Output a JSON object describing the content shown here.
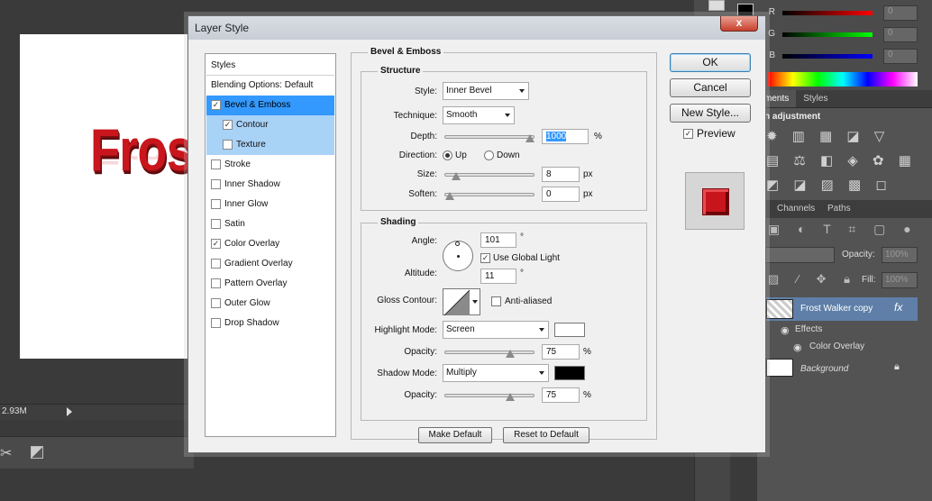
{
  "background": {
    "canvas_text": "Fros",
    "status_size": "2.93M"
  },
  "color_panel": {
    "channels": [
      {
        "label": "R",
        "value": "0",
        "color": "#ff2020"
      },
      {
        "label": "G",
        "value": "0",
        "color": "#20c020"
      },
      {
        "label": "B",
        "value": "0",
        "color": "#2040ff"
      }
    ]
  },
  "adjustments_panel": {
    "tabs": [
      "ments",
      "Styles"
    ],
    "heading": "n adjustment"
  },
  "layers_panel": {
    "tabs": [
      "Channels",
      "Paths"
    ],
    "opacity_label": "Opacity:",
    "opacity_value": "100%",
    "fill_label": "Fill:",
    "fill_value": "100%",
    "layers": [
      {
        "name": "Frost Walker copy",
        "fx": "fx"
      },
      {
        "name": "Effects"
      },
      {
        "name": "Color Overlay"
      },
      {
        "name": "Background"
      }
    ]
  },
  "dialog": {
    "title": "Layer Style",
    "close": "x",
    "styles": [
      {
        "label": "Styles",
        "checkbox": false,
        "checked": false
      },
      {
        "label": "Blending Options: Default",
        "checkbox": false,
        "checked": false
      },
      {
        "label": "Bevel & Emboss",
        "checkbox": true,
        "checked": true
      },
      {
        "label": "Contour",
        "checkbox": true,
        "checked": true
      },
      {
        "label": "Texture",
        "checkbox": true,
        "checked": false
      },
      {
        "label": "Stroke",
        "checkbox": true,
        "checked": false
      },
      {
        "label": "Inner Shadow",
        "checkbox": true,
        "checked": false
      },
      {
        "label": "Inner Glow",
        "checkbox": true,
        "checked": false
      },
      {
        "label": "Satin",
        "checkbox": true,
        "checked": false
      },
      {
        "label": "Color Overlay",
        "checkbox": true,
        "checked": true
      },
      {
        "label": "Gradient Overlay",
        "checkbox": true,
        "checked": false
      },
      {
        "label": "Pattern Overlay",
        "checkbox": true,
        "checked": false
      },
      {
        "label": "Outer Glow",
        "checkbox": true,
        "checked": false
      },
      {
        "label": "Drop Shadow",
        "checkbox": true,
        "checked": false
      }
    ],
    "bevel": {
      "title": "Bevel & Emboss",
      "structure_title": "Structure",
      "style_label": "Style:",
      "style_value": "Inner Bevel",
      "technique_label": "Technique:",
      "technique_value": "Smooth",
      "depth_label": "Depth:",
      "depth_value": "1000",
      "depth_unit": "%",
      "depth_level": 1.0,
      "direction_label": "Direction:",
      "dir_up": "Up",
      "dir_down": "Down",
      "size_label": "Size:",
      "size_value": "8",
      "size_unit": "px",
      "size_level": 0.08,
      "soften_label": "Soften:",
      "soften_value": "0",
      "soften_unit": "px",
      "soften_level": 0.0
    },
    "shading": {
      "title": "Shading",
      "angle_label": "Angle:",
      "angle_value": "101",
      "deg": "°",
      "global_light": "Use Global Light",
      "altitude_label": "Altitude:",
      "altitude_value": "11",
      "gloss_label": "Gloss Contour:",
      "anti_aliased": "Anti-aliased",
      "highlight_label": "Highlight Mode:",
      "highlight_value": "Screen",
      "highlight_color": "#ffffff",
      "opacity_label": "Opacity:",
      "highlight_opacity": "75",
      "shadow_label": "Shadow Mode:",
      "shadow_value": "Multiply",
      "shadow_color": "#000000",
      "shadow_opacity": "75",
      "pct": "%",
      "opacity_level": 0.75
    },
    "make_default": "Make Default",
    "reset_default": "Reset to Default",
    "ok": "OK",
    "cancel": "Cancel",
    "new_style": "New Style...",
    "preview": "Preview"
  }
}
